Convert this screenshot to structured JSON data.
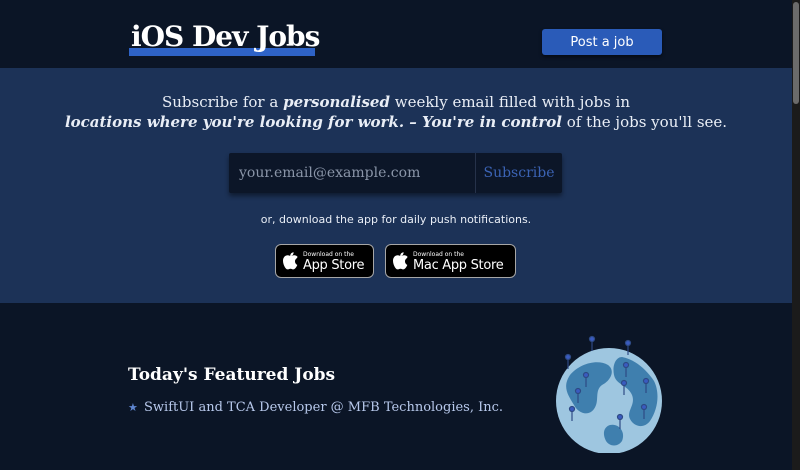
{
  "header": {
    "logo": "iOS Dev Jobs",
    "post_job_label": "Post a job"
  },
  "hero": {
    "tagline": {
      "p1": "Subscribe for a ",
      "em1": "personalised",
      "p2": " weekly email filled with jobs in ",
      "em2": "locations where you're looking for work. – You're in control",
      "p3": " of the jobs you'll see."
    },
    "email_placeholder": "your.email@example.com",
    "subscribe_label": "Subscribe",
    "or_text": "or, download the app for daily push notifications.",
    "badges": [
      {
        "small": "Download on the",
        "big": "App Store"
      },
      {
        "small": "Download on the",
        "big": "Mac App Store"
      }
    ]
  },
  "featured": {
    "title": "Today's Featured Jobs",
    "jobs": [
      {
        "label": "SwiftUI and TCA Developer @ MFB Technologies, Inc."
      }
    ]
  },
  "colors": {
    "background": "#0b1526",
    "hero": "#1c3257",
    "accent": "#2a5bb8",
    "link": "#b8c9ec"
  },
  "icons": [
    "apple-icon",
    "star-icon",
    "globe-illustration"
  ]
}
